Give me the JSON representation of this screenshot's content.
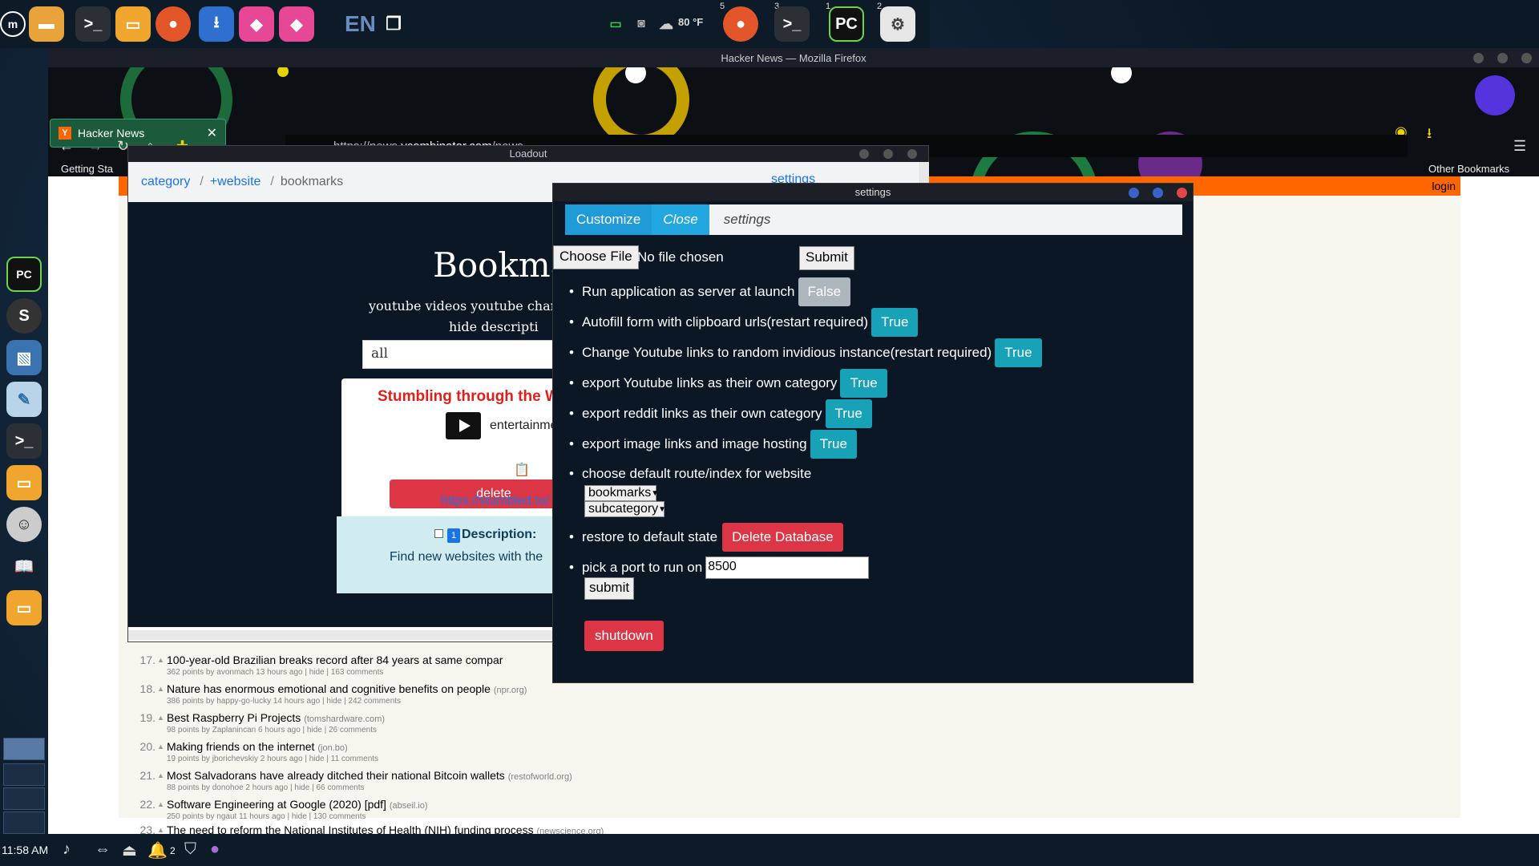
{
  "top_panel": {
    "keyboard_layout": "EN",
    "weather": "80 °F",
    "workspace_numbers": [
      "5",
      "3",
      "1",
      "2"
    ],
    "pycharm_label": "PC"
  },
  "bottom_panel": {
    "clock": "11:58 AM",
    "notification_count": "2"
  },
  "firefox": {
    "window_title": "Hacker News — Mozilla Firefox",
    "tab_title": "Hacker News",
    "tab_favicon": "Y",
    "url_prefix": "https://news.",
    "url_host": "ycombinator.com",
    "url_path": "/news",
    "bookmark_left": "Getting Sta",
    "bookmark_right": "Other Bookmarks"
  },
  "hn": {
    "login": "login",
    "items": [
      {
        "rank": "17.",
        "title": "100-year-old Brazilian breaks record after 84 years at same compar",
        "domain": "",
        "sub": "362 points by avonmach 13 hours ago | hide | 163 comments"
      },
      {
        "rank": "18.",
        "title": "Nature has enormous emotional and cognitive benefits on people",
        "domain": "(npr.org)",
        "sub": "386 points by happy-go-lucky 14 hours ago | hide | 242 comments"
      },
      {
        "rank": "19.",
        "title": "Best Raspberry Pi Projects",
        "domain": "(tomshardware.com)",
        "sub": "98 points by Zaplanincan 6 hours ago | hide | 26 comments"
      },
      {
        "rank": "20.",
        "title": "Making friends on the internet",
        "domain": "(jon.bo)",
        "sub": "19 points by jborichevskiy 2 hours ago | hide | 11 comments"
      },
      {
        "rank": "21.",
        "title": "Most Salvadorans have already ditched their national Bitcoin wallets",
        "domain": "(restofworld.org)",
        "sub": "88 points by donohoe 2 hours ago | hide | 66 comments"
      },
      {
        "rank": "22.",
        "title": "Software Engineering at Google (2020) [pdf]",
        "domain": "(abseil.io)",
        "sub": "250 points by ngaut 11 hours ago | hide | 130 comments"
      },
      {
        "rank": "23.",
        "title": "The need to reform the National Institutes of Health (NIH) funding process",
        "domain": "(newscience.org)",
        "sub": ""
      }
    ]
  },
  "loadout": {
    "window_title": "Loadout",
    "breadcrumb": [
      "category",
      "+website",
      "bookmarks"
    ],
    "settings_link": "settings",
    "heading": "Bookma",
    "subtitle_1": "youtube videos youtube chan",
    "subtitle_2": "hide descripti",
    "search_value": "all",
    "card": {
      "title": "Stumbling through the We",
      "category": "entertainmen",
      "delete_label": "delete",
      "url": "https://stumbled.to/"
    },
    "desc_card": {
      "badge": "1",
      "title": "Description:",
      "text": "Find new websites with the"
    }
  },
  "settings": {
    "window_title": "settings",
    "tabs": [
      "Customize",
      "Close"
    ],
    "crumb_current": "settings",
    "choose_file_label": "Choose File",
    "no_file_text": "No file chosen",
    "submit_label": "Submit",
    "options": [
      {
        "label": "Run application as server at launch",
        "value": "False"
      },
      {
        "label": "Autofill form with clipboard urls(restart required)",
        "value": "True"
      },
      {
        "label": "Change Youtube links to random invidious instance(restart required)",
        "value": "True"
      },
      {
        "label": "export Youtube links as their own category",
        "value": "True"
      },
      {
        "label": "export reddit links as their own category",
        "value": "True"
      },
      {
        "label": "export image links and image hosting",
        "value": "True"
      }
    ],
    "route_label": "choose default route/index for website",
    "route_select_1": "bookmarks",
    "route_select_2": "subcategory",
    "restore_label": "restore to default state",
    "delete_db_label": "Delete Database",
    "port_label": "pick a port to run on",
    "port_value": "8500",
    "port_submit_label": "submit",
    "shutdown_label": "shutdown"
  }
}
